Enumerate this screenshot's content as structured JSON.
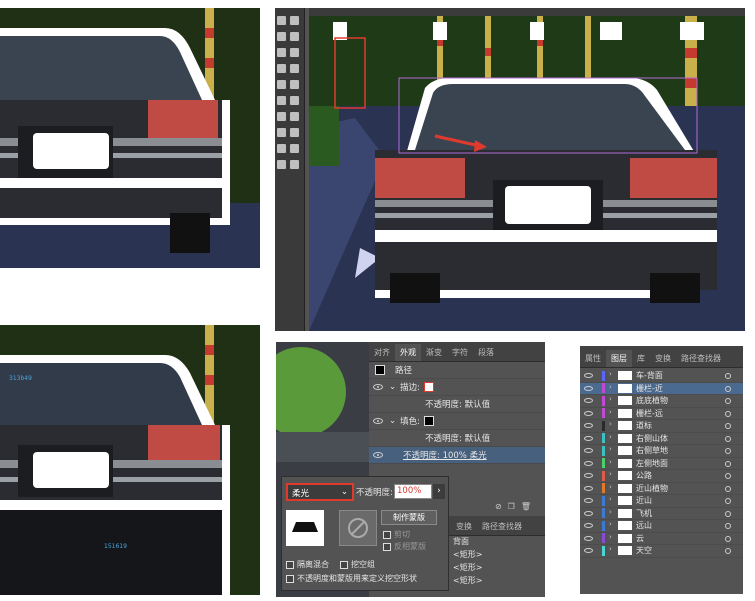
{
  "canvas_labels": {
    "color_a": "313b49",
    "color_b": "151619"
  },
  "appearance_panel": {
    "tabs": [
      "对齐",
      "外观",
      "渐变",
      "字符",
      "段落"
    ],
    "active_tab": "外观",
    "rows": [
      {
        "label": "路径"
      },
      {
        "label": "描边:"
      },
      {
        "label": "不透明度: 默认值"
      },
      {
        "label": "填色:"
      },
      {
        "label": "不透明度: 默认值"
      },
      {
        "label": "不透明度: 100% 柔光"
      }
    ],
    "lower_tabs": [
      "变换",
      "路径查找器"
    ],
    "lower_rows": [
      "背面",
      "<矩形>",
      "<矩形>",
      "<矩形>"
    ]
  },
  "transparency_panel": {
    "blend_mode": "柔光",
    "opacity_label": "不透明度:",
    "opacity_value": "100%",
    "make_mask_button": "制作蒙版",
    "clip_label": "剪切",
    "invert_label": "反相蒙版",
    "isolate_label": "隔离混合",
    "knockout_label": "挖空组",
    "opacity_mask_label": "不透明度和蒙版用来定义挖空形状"
  },
  "layers_panel": {
    "tabs": [
      "属性",
      "图层",
      "库",
      "变换",
      "路径查找器"
    ],
    "active_tab": "图层",
    "layers": [
      {
        "name": "车-背面",
        "color": "#5a66ff"
      },
      {
        "name": "栅栏-近",
        "color": "#c04ad6"
      },
      {
        "name": "底底植物",
        "color": "#c04ad6"
      },
      {
        "name": "栅栏-远",
        "color": "#c04ad6"
      },
      {
        "name": "道标",
        "color": "#2a2a2a"
      },
      {
        "name": "右侧山体",
        "color": "#3cc0c0"
      },
      {
        "name": "右侧草地",
        "color": "#3cc0c0"
      },
      {
        "name": "左侧地面",
        "color": "#4bd06a"
      },
      {
        "name": "公路",
        "color": "#e05a4a"
      },
      {
        "name": "近山植物",
        "color": "#e07a2a"
      },
      {
        "name": "近山",
        "color": "#3c7ad6"
      },
      {
        "name": "飞机",
        "color": "#3c7ad6"
      },
      {
        "name": "远山",
        "color": "#3c7ad6"
      },
      {
        "name": "云",
        "color": "#8a4ad6"
      },
      {
        "name": "天空",
        "color": "#4ad6d6"
      }
    ],
    "selected_index": 1
  }
}
